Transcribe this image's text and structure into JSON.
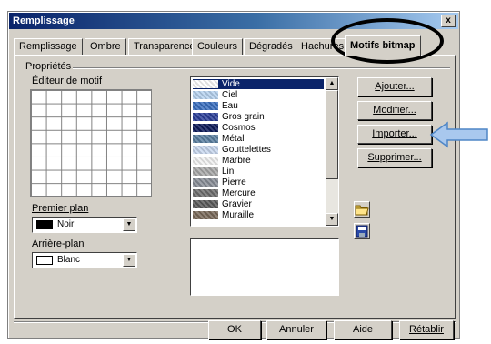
{
  "window": {
    "title": "Remplissage",
    "close_label": "x"
  },
  "tabs": [
    {
      "label": "Remplissage"
    },
    {
      "label": "Ombre"
    },
    {
      "label": "Transparence"
    },
    {
      "label": "Couleurs"
    },
    {
      "label": "Dégradés"
    },
    {
      "label": "Hachures"
    },
    {
      "label": "Motifs bitmap",
      "active": true
    }
  ],
  "properties": {
    "group_label": "Propriétés",
    "pattern_editor_label": "Éditeur de motif",
    "foreground_label": "Premier plan",
    "foreground_value": "Noir",
    "foreground_color": "#000000",
    "background_label": "Arrière-plan",
    "background_value": "Blanc",
    "background_color": "#ffffff"
  },
  "bitmap_list": {
    "items": [
      {
        "label": "Vide",
        "selected": true,
        "color": "#ffffff"
      },
      {
        "label": "Ciel",
        "color": "#b7d3f0"
      },
      {
        "label": "Eau",
        "color": "#3a6fc0"
      },
      {
        "label": "Gros grain",
        "color": "#2b3f9a"
      },
      {
        "label": "Cosmos",
        "color": "#0c1a5a"
      },
      {
        "label": "Métal",
        "color": "#5a7fa0"
      },
      {
        "label": "Gouttelettes",
        "color": "#c9d8ef"
      },
      {
        "label": "Marbre",
        "color": "#f2f2f2"
      },
      {
        "label": "Lin",
        "color": "#a8a8a8"
      },
      {
        "label": "Pierre",
        "color": "#8a8f98"
      },
      {
        "label": "Mercure",
        "color": "#6e6e6e"
      },
      {
        "label": "Gravier",
        "color": "#5b5b5b"
      },
      {
        "label": "Muraille",
        "color": "#7a6a5a"
      }
    ]
  },
  "actions": {
    "add": "Ajouter...",
    "modify": "Modifier...",
    "import": "Importer...",
    "delete": "Supprimer..."
  },
  "footer": {
    "ok": "OK",
    "cancel": "Annuler",
    "help": "Aide",
    "reset": "Rétablir"
  },
  "colors": {
    "arrow_fill": "#a9c8ee",
    "arrow_stroke": "#4f86c6",
    "highlight_ellipse": "#000000"
  }
}
